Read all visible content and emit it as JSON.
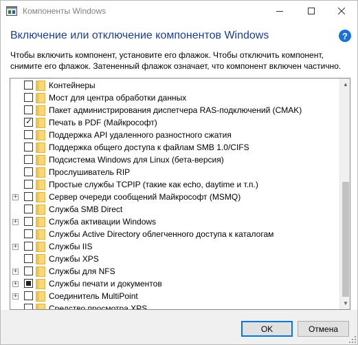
{
  "window": {
    "title": "Компоненты Windows",
    "app_icon": "windows-features-icon"
  },
  "caption_buttons": {
    "minimize": "minimize-icon",
    "maximize": "maximize-icon",
    "close": "close-icon"
  },
  "content": {
    "heading": "Включение или отключение компонентов Windows",
    "help_icon": "?",
    "description_line1": "Чтобы включить компонент, установите его флажок. Чтобы отключить компонент,",
    "description_line2": "снимите его флажок. Затененный флажок означает, что компонент включен частично."
  },
  "features": [
    {
      "label": "Контейнеры",
      "state": "unchecked",
      "expandable": false
    },
    {
      "label": "Мост для центра обработки данных",
      "state": "unchecked",
      "expandable": false
    },
    {
      "label": "Пакет администрирования диспетчера RAS-подключений (CMAK)",
      "state": "unchecked",
      "expandable": false
    },
    {
      "label": "Печать в PDF (Майкрософт)",
      "state": "checked",
      "expandable": false
    },
    {
      "label": "Поддержка API удаленного разностного сжатия",
      "state": "unchecked",
      "expandable": false
    },
    {
      "label": "Поддержка общего доступа к файлам SMB 1.0/CIFS",
      "state": "unchecked",
      "expandable": false
    },
    {
      "label": "Подсистема Windows для Linux (бета-версия)",
      "state": "unchecked",
      "expandable": false
    },
    {
      "label": "Прослушиватель RIP",
      "state": "unchecked",
      "expandable": false
    },
    {
      "label": "Простые службы TCPIP (такие как echo, daytime и т.п.)",
      "state": "unchecked",
      "expandable": false
    },
    {
      "label": "Сервер очереди сообщений Майкрософт (MSMQ)",
      "state": "unchecked",
      "expandable": true
    },
    {
      "label": "Служба SMB Direct",
      "state": "unchecked",
      "expandable": false
    },
    {
      "label": "Служба активации Windows",
      "state": "unchecked",
      "expandable": true
    },
    {
      "label": "Службы Active Directory облегченного доступа к каталогам",
      "state": "unchecked",
      "expandable": false
    },
    {
      "label": "Службы IIS",
      "state": "unchecked",
      "expandable": true
    },
    {
      "label": "Службы XPS",
      "state": "unchecked",
      "expandable": false
    },
    {
      "label": "Службы для NFS",
      "state": "unchecked",
      "expandable": true
    },
    {
      "label": "Службы печати и документов",
      "state": "partial",
      "expandable": true
    },
    {
      "label": "Соединитель MultiPoint",
      "state": "unchecked",
      "expandable": true
    },
    {
      "label": "Средство просмотра XPS",
      "state": "unchecked",
      "expandable": false
    }
  ],
  "scrollbar": {
    "up_icon": "scroll-up-arrow-icon",
    "down_icon": "scroll-down-arrow-icon"
  },
  "buttons": {
    "ok": "OK",
    "cancel": "Отмена"
  },
  "colors": {
    "heading": "#1a3f8c",
    "help_icon_bg": "#1773d9",
    "ok_border": "#0078d7",
    "folder": "#f8d775"
  }
}
